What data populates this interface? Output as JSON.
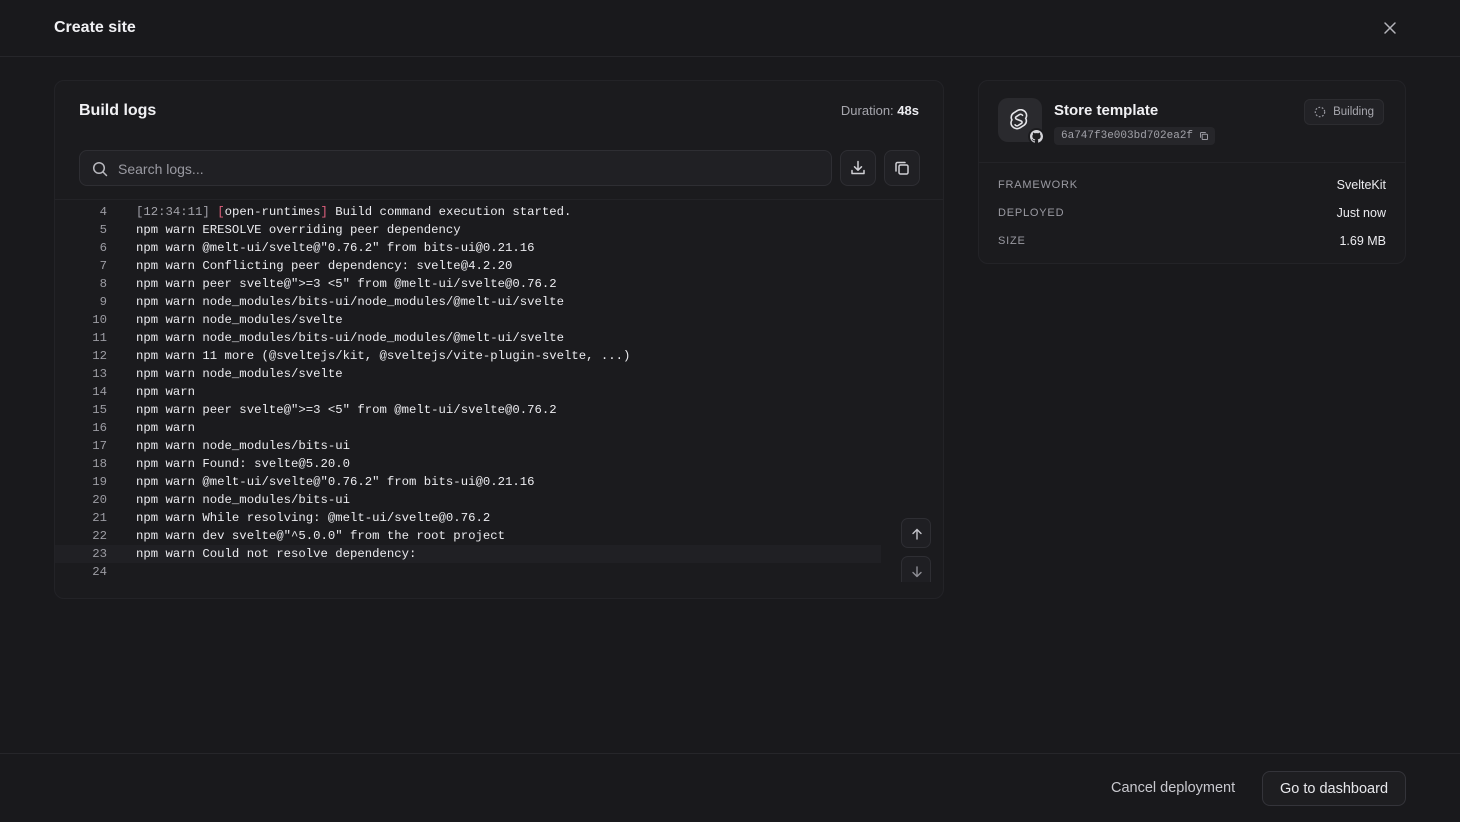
{
  "modal": {
    "title": "Create site"
  },
  "logs": {
    "title": "Build logs",
    "duration_label": "Duration:",
    "duration_value": "48s",
    "search_placeholder": "Search logs...",
    "first_line": {
      "num": "4",
      "timestamp": "[12:34:11]",
      "bracket_open": "[",
      "source": "open-runtimes",
      "bracket_close": "]",
      "message": " Build command execution started."
    },
    "lines": [
      {
        "num": "5",
        "text": "npm warn ERESOLVE overriding peer dependency"
      },
      {
        "num": "6",
        "text": "npm warn @melt-ui/svelte@\"0.76.2\" from bits-ui@0.21.16"
      },
      {
        "num": "7",
        "text": "npm warn Conflicting peer dependency: svelte@4.2.20"
      },
      {
        "num": "8",
        "text": "npm warn peer svelte@\">=3 <5\" from @melt-ui/svelte@0.76.2"
      },
      {
        "num": "9",
        "text": "npm warn node_modules/bits-ui/node_modules/@melt-ui/svelte"
      },
      {
        "num": "10",
        "text": "npm warn node_modules/svelte"
      },
      {
        "num": "11",
        "text": "npm warn node_modules/bits-ui/node_modules/@melt-ui/svelte"
      },
      {
        "num": "12",
        "text": "npm warn 11 more (@sveltejs/kit, @sveltejs/vite-plugin-svelte, ...)"
      },
      {
        "num": "13",
        "text": "npm warn node_modules/svelte"
      },
      {
        "num": "14",
        "text": "npm warn"
      },
      {
        "num": "15",
        "text": "npm warn peer svelte@\">=3 <5\" from @melt-ui/svelte@0.76.2"
      },
      {
        "num": "16",
        "text": "npm warn"
      },
      {
        "num": "17",
        "text": "npm warn node_modules/bits-ui"
      },
      {
        "num": "18",
        "text": "npm warn Found: svelte@5.20.0"
      },
      {
        "num": "19",
        "text": "npm warn @melt-ui/svelte@\"0.76.2\" from bits-ui@0.21.16"
      },
      {
        "num": "20",
        "text": "npm warn node_modules/bits-ui"
      },
      {
        "num": "21",
        "text": "npm warn While resolving: @melt-ui/svelte@0.76.2"
      },
      {
        "num": "22",
        "text": "npm warn dev svelte@\"^5.0.0\" from the root project"
      },
      {
        "num": "23",
        "text": "npm warn Could not resolve dependency:"
      },
      {
        "num": "24",
        "text": ""
      }
    ]
  },
  "site": {
    "name": "Store template",
    "commit_hash": "6a747f3e003bd702ea2f",
    "status": "Building",
    "details": [
      {
        "key": "FRAMEWORK",
        "value": "SvelteKit"
      },
      {
        "key": "DEPLOYED",
        "value": "Just now"
      },
      {
        "key": "SIZE",
        "value": "1.69 MB"
      }
    ]
  },
  "footer": {
    "cancel_label": "Cancel deployment",
    "dashboard_label": "Go to dashboard"
  },
  "colors": {
    "background": "#19191c",
    "log_bracket": "#e0607e"
  }
}
